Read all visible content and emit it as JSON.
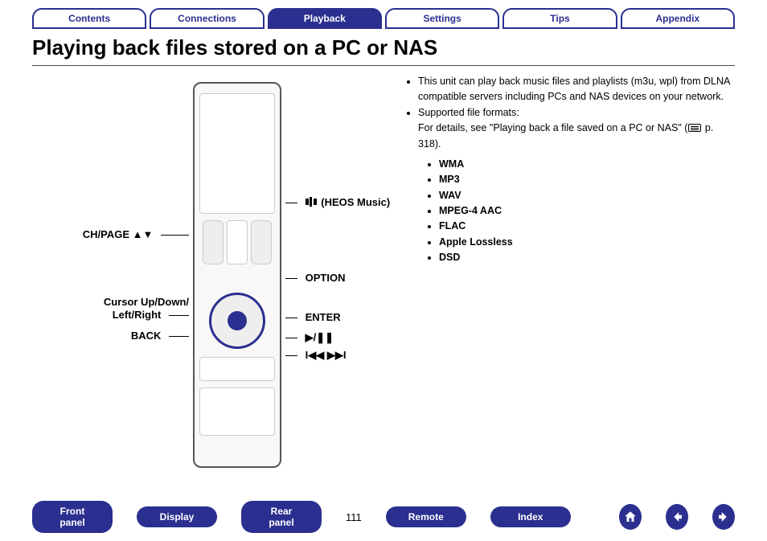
{
  "tabs": {
    "items": [
      "Contents",
      "Connections",
      "Playback",
      "Settings",
      "Tips",
      "Appendix"
    ],
    "active_index": 2
  },
  "title": "Playing back files stored on a PC or NAS",
  "remote_labels": {
    "ch_page": "CH/PAGE ▲▼",
    "cursor_line1": "Cursor Up/Down/",
    "cursor_line2": "Left/Right",
    "back": "BACK",
    "heos": "(HEOS Music)",
    "option": "OPTION",
    "enter": "ENTER",
    "play_pause": "▶/❚❚",
    "skip": "I◀◀ ▶▶I"
  },
  "right": {
    "bullet1": "This unit can play back music files and playlists (m3u, wpl) from DLNA compatible servers including PCs and NAS devices on your network.",
    "bullet2_line1": "Supported file formats:",
    "bullet2_line2a": "For details, see \"Playing back a file saved on a PC or NAS\" (",
    "bullet2_line2b": " p. 318).",
    "formats": [
      "WMA",
      "MP3",
      "WAV",
      "MPEG-4 AAC",
      "FLAC",
      "Apple Lossless",
      "DSD"
    ]
  },
  "footer": {
    "buttons": [
      "Front panel",
      "Display",
      "Rear panel",
      "Remote",
      "Index"
    ],
    "page": "111"
  }
}
